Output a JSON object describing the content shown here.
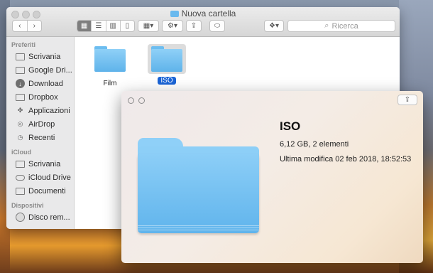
{
  "window": {
    "title": "Nuova cartella"
  },
  "toolbar": {
    "back_icon": "chevron-left-icon",
    "forward_icon": "chevron-right-icon",
    "view_modes": [
      "icon-view",
      "list-view",
      "column-view",
      "coverflow-view"
    ],
    "search_placeholder": "Ricerca"
  },
  "sidebar": {
    "sections": [
      {
        "title": "Preferiti",
        "items": [
          {
            "label": "Scrivania",
            "icon": "desktop-icon"
          },
          {
            "label": "Google Dri...",
            "icon": "folder-icon"
          },
          {
            "label": "Download",
            "icon": "download-icon"
          },
          {
            "label": "Dropbox",
            "icon": "folder-icon"
          },
          {
            "label": "Applicazioni",
            "icon": "apps-icon"
          },
          {
            "label": "AirDrop",
            "icon": "airdrop-icon"
          },
          {
            "label": "Recenti",
            "icon": "clock-icon"
          }
        ]
      },
      {
        "title": "iCloud",
        "items": [
          {
            "label": "Scrivania",
            "icon": "desktop-icon"
          },
          {
            "label": "iCloud Drive",
            "icon": "cloud-icon"
          },
          {
            "label": "Documenti",
            "icon": "document-icon"
          }
        ]
      },
      {
        "title": "Dispositivi",
        "items": [
          {
            "label": "Disco rem...",
            "icon": "disk-icon"
          }
        ]
      }
    ]
  },
  "files": [
    {
      "name": "Film",
      "selected": false
    },
    {
      "name": "ISO",
      "selected": true
    }
  ],
  "quicklook": {
    "name": "ISO",
    "info": "6,12 GB, 2 elementi",
    "modified": "Ultima modifica 02 feb 2018, 18:52:53"
  },
  "colors": {
    "folder": "#69b9ee",
    "selection": "#1a64d6"
  }
}
